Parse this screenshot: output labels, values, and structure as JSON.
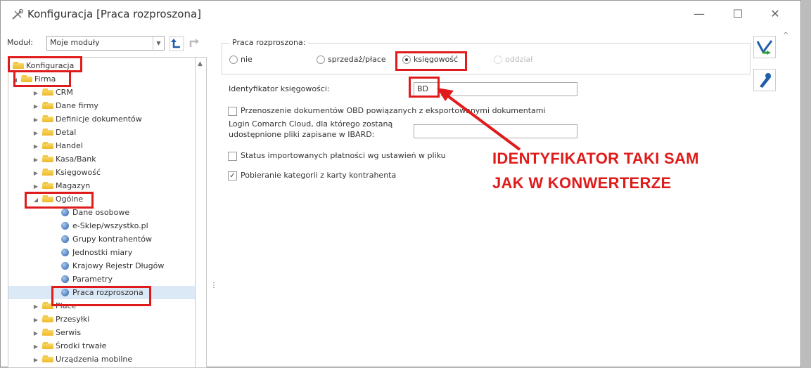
{
  "window": {
    "title": "Konfiguracja [Praca rozproszona]",
    "minimize": "—",
    "maximize": "☐",
    "close": "✕"
  },
  "toolbar": {
    "modul_label": "Moduł:",
    "modul_value": "Moje moduły"
  },
  "tree": {
    "root": "Konfiguracja",
    "firma": "Firma",
    "items": [
      "CRM",
      "Dane firmy",
      "Definicje dokumentów",
      "Detal",
      "Handel",
      "Kasa/Bank",
      "Księgowość",
      "Magazyn"
    ],
    "ogolne": "Ogólne",
    "ogolne_children": [
      "Dane osobowe",
      "e-Sklep/wszystko.pl",
      "Grupy kontrahentów",
      "Jednostki miary",
      "Krajowy Rejestr Długów",
      "Parametry",
      "Praca rozproszona"
    ],
    "after": [
      "Płace",
      "Przesyłki",
      "Serwis",
      "Środki trwałe",
      "Urządzenia mobilne"
    ]
  },
  "form": {
    "group_label": "Praca rozproszona:",
    "radios": [
      "nie",
      "sprzedaż/płace",
      "księgowość",
      "oddział"
    ],
    "selected_radio": "księgowość",
    "ident_label": "Identyfikator księgowości:",
    "ident_value": "BD",
    "chk1_label": "Przenoszenie dokumentów OBD powiązanych z eksportowanymi dokumentami",
    "login_label_1": "Login Comarch Cloud, dla którego zostaną",
    "login_label_2": "udostępnione pliki zapisane w IBARD:",
    "login_value": "",
    "chk2_label": "Status importowanych płatności wg ustawień w pliku",
    "chk3_label": "Pobieranie kategorii z karty kontrahenta",
    "chk3_checked": true
  },
  "annotation": {
    "line1": "IDENTYFIKATOR TAKI SAM",
    "line2": "JAK W KONWERTERZE"
  },
  "colors": {
    "highlight_red": "#e01b1b",
    "selection": "#dbe9f7"
  }
}
